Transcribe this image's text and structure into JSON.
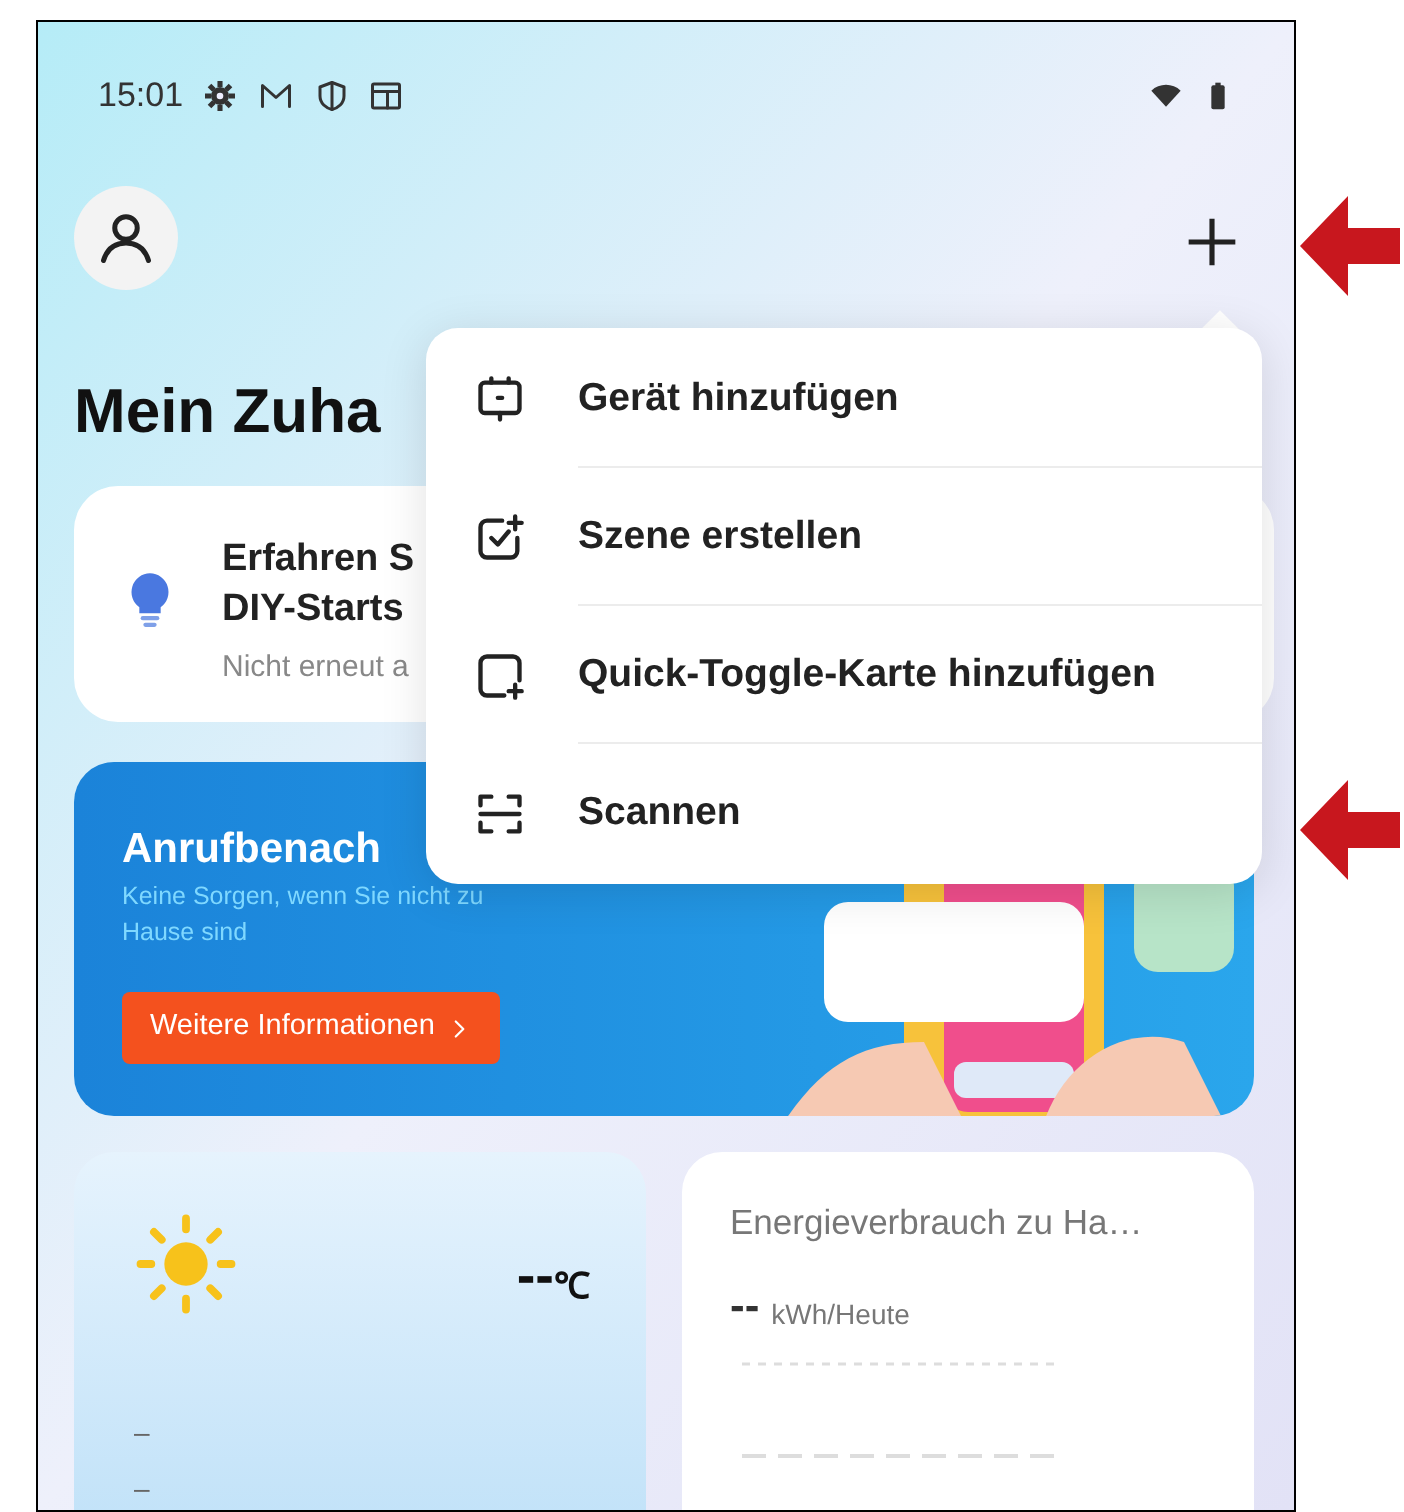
{
  "status_bar": {
    "time": "15:01"
  },
  "header": {
    "title": "Mein Zuha"
  },
  "tip_card": {
    "title_lines": [
      "Erfahren S",
      "DIY-Starts"
    ],
    "subtitle": "Nicht erneut a"
  },
  "banner": {
    "title": "Anrufbenach",
    "text": "Keine Sorgen, wenn Sie nicht zu Hause sind",
    "button": "Weitere Informationen"
  },
  "weather_card": {
    "temperature": "--",
    "unit": "℃",
    "lines": [
      "–",
      "–"
    ]
  },
  "energy_card": {
    "title": "Energieverbrauch zu Ha…",
    "value": "--",
    "unit": "kWh/Heute"
  },
  "menu": {
    "items": [
      {
        "kind": "device",
        "label": "Gerät hinzufügen"
      },
      {
        "kind": "scene",
        "label": "Szene erstellen"
      },
      {
        "kind": "card",
        "label": "Quick-Toggle-Karte hinzufügen"
      },
      {
        "kind": "scan",
        "label": "Scannen"
      }
    ]
  }
}
